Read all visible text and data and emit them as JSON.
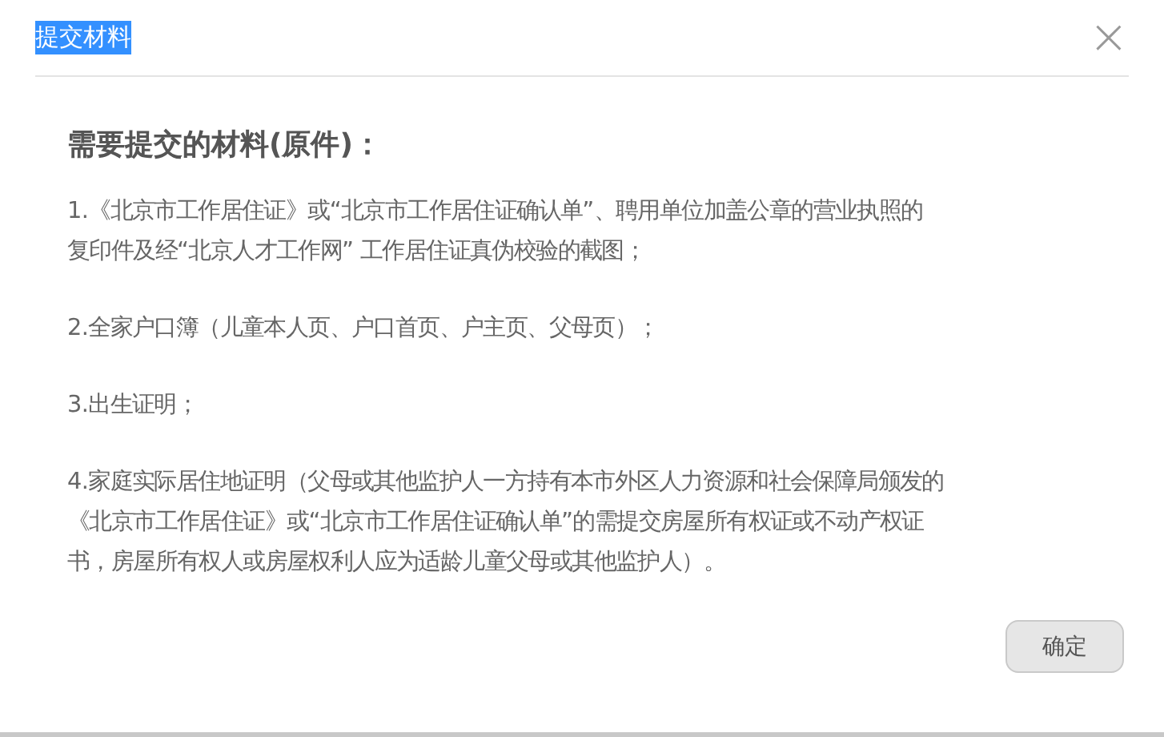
{
  "dialog": {
    "title": "提交材料",
    "title_selected": true,
    "close_label": "×"
  },
  "heading": "需要提交的材料(原件)：",
  "items": [
    {
      "lines": [
        "1.《北京市工作居住证》或“北京市工作居住证确认单”、聘用单位加盖公章的营业执照的",
        "复印件及经“北京人才工作网” 工作居住证真伪校验的截图；"
      ]
    },
    {
      "lines": [
        "2.全家户口簿（儿童本人页、户口首页、户主页、父母页）；"
      ]
    },
    {
      "lines": [
        "3.出生证明；"
      ]
    },
    {
      "lines": [
        "4.家庭实际居住地证明（父母或其他监护人一方持有本市外区人力资源和社会保障局颁发的",
        "《北京市工作居住证》或“北京市工作居住证确认单”的需提交房屋所有权证或不动产权证",
        "书，房屋所有权人或房屋权利人应为适龄儿童父母或其他监护人）。"
      ]
    }
  ],
  "buttons": [
    "确定"
  ]
}
